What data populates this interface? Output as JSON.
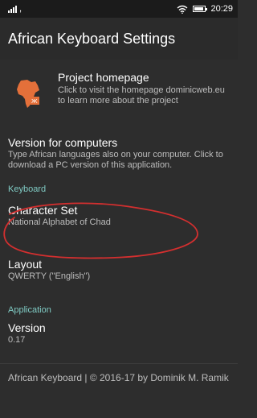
{
  "status_bar": {
    "carrier_mark": ",",
    "time": "20:29"
  },
  "app_bar": {
    "title": "African Keyboard Settings"
  },
  "prefs": {
    "homepage": {
      "title": "Project homepage",
      "summary": "Click to visit the homepage dominicweb.eu to learn more about the project"
    },
    "pc_version": {
      "title": "Version for computers",
      "summary": "Type African languages also on your computer. Click to download a PC version of this application."
    },
    "keyboard_category": "Keyboard",
    "character_set": {
      "title": "Character Set",
      "summary": "National Alphabet of Chad"
    },
    "layout": {
      "title": "Layout",
      "summary": "QWERTY (\"English\")"
    },
    "application_category": "Application",
    "version": {
      "title": "Version",
      "summary": "0.17"
    },
    "credits": "African Keyboard | © 2016-17 by Dominik M. Ramik"
  },
  "colors": {
    "background": "#2d2d2d",
    "accent": "#80cbc4",
    "annotation": "#d32f2f",
    "logo_orange": "#e4703a"
  },
  "icons": {
    "signal": "signal-icon",
    "wifi": "wifi-icon",
    "battery": "battery-icon",
    "logo": "africa-logo-icon"
  }
}
